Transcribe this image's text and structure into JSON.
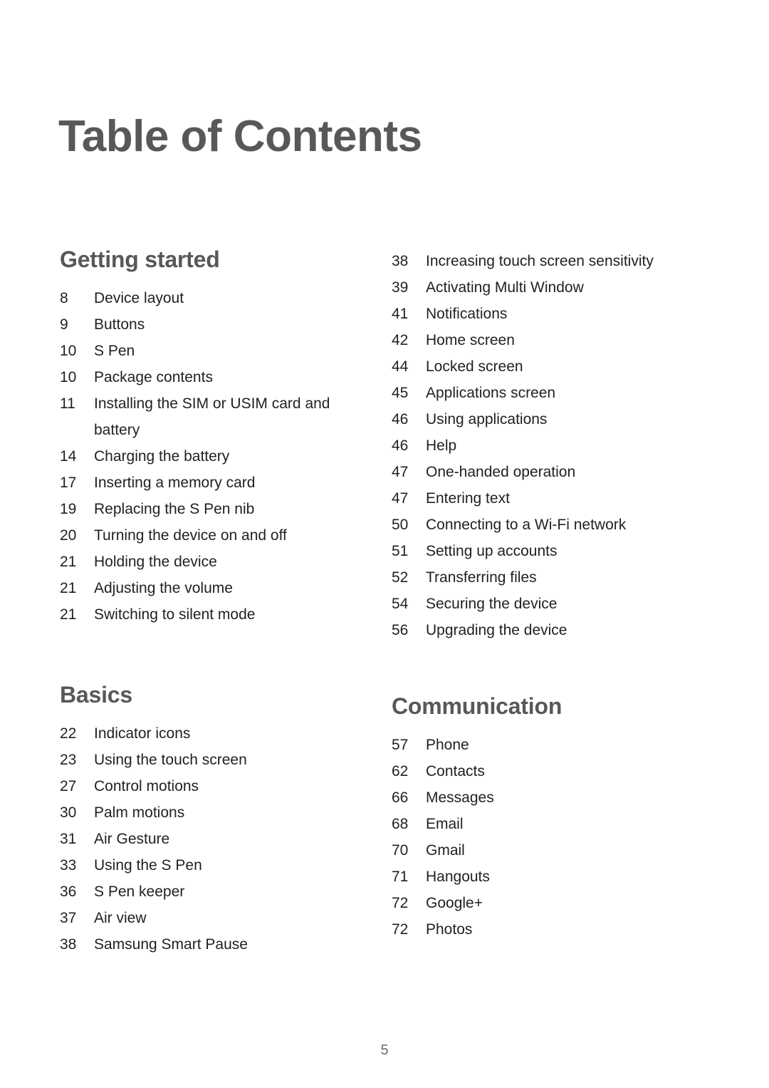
{
  "document": {
    "title": "Table of Contents",
    "page_number": "5"
  },
  "columns": {
    "left": [
      {
        "heading": "Getting started",
        "entries": [
          {
            "page": "8",
            "label": "Device layout"
          },
          {
            "page": "9",
            "label": "Buttons"
          },
          {
            "page": "10",
            "label": "S Pen"
          },
          {
            "page": "10",
            "label": "Package contents"
          },
          {
            "page": "11",
            "label": "Installing the SIM or USIM card and battery"
          },
          {
            "page": "14",
            "label": "Charging the battery"
          },
          {
            "page": "17",
            "label": "Inserting a memory card"
          },
          {
            "page": "19",
            "label": "Replacing the S Pen nib"
          },
          {
            "page": "20",
            "label": "Turning the device on and off"
          },
          {
            "page": "21",
            "label": "Holding the device"
          },
          {
            "page": "21",
            "label": "Adjusting the volume"
          },
          {
            "page": "21",
            "label": "Switching to silent mode"
          }
        ]
      },
      {
        "heading": "Basics",
        "entries": [
          {
            "page": "22",
            "label": "Indicator icons"
          },
          {
            "page": "23",
            "label": "Using the touch screen"
          },
          {
            "page": "27",
            "label": "Control motions"
          },
          {
            "page": "30",
            "label": "Palm motions"
          },
          {
            "page": "31",
            "label": "Air Gesture"
          },
          {
            "page": "33",
            "label": "Using the S Pen"
          },
          {
            "page": "36",
            "label": "S Pen keeper"
          },
          {
            "page": "37",
            "label": "Air view"
          },
          {
            "page": "38",
            "label": "Samsung Smart Pause"
          }
        ]
      }
    ],
    "right": [
      {
        "heading": "",
        "entries": [
          {
            "page": "38",
            "label": "Increasing touch screen sensitivity"
          },
          {
            "page": "39",
            "label": "Activating Multi Window"
          },
          {
            "page": "41",
            "label": "Notifications"
          },
          {
            "page": "42",
            "label": "Home screen"
          },
          {
            "page": "44",
            "label": "Locked screen"
          },
          {
            "page": "45",
            "label": "Applications screen"
          },
          {
            "page": "46",
            "label": "Using applications"
          },
          {
            "page": "46",
            "label": "Help"
          },
          {
            "page": "47",
            "label": "One-handed operation"
          },
          {
            "page": "47",
            "label": "Entering text"
          },
          {
            "page": "50",
            "label": "Connecting to a Wi-Fi network"
          },
          {
            "page": "51",
            "label": "Setting up accounts"
          },
          {
            "page": "52",
            "label": "Transferring files"
          },
          {
            "page": "54",
            "label": "Securing the device"
          },
          {
            "page": "56",
            "label": "Upgrading the device"
          }
        ]
      },
      {
        "heading": "Communication",
        "entries": [
          {
            "page": "57",
            "label": "Phone"
          },
          {
            "page": "62",
            "label": "Contacts"
          },
          {
            "page": "66",
            "label": "Messages"
          },
          {
            "page": "68",
            "label": "Email"
          },
          {
            "page": "70",
            "label": "Gmail"
          },
          {
            "page": "71",
            "label": "Hangouts"
          },
          {
            "page": "72",
            "label": "Google+"
          },
          {
            "page": "72",
            "label": "Photos"
          }
        ]
      }
    ]
  }
}
